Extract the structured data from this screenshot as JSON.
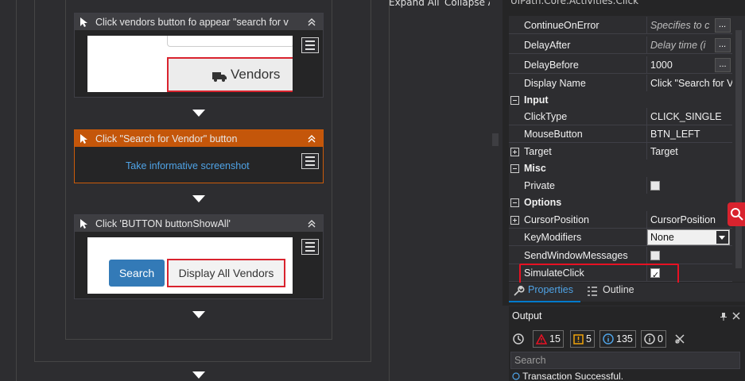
{
  "toolbar": {
    "expand_all": "Expand All",
    "collapse_all": "Collapse All"
  },
  "activities": [
    {
      "title": "Click vendors button fo appear \"search for v",
      "button_text": "Vendors"
    },
    {
      "title": "Click \"Search for Vendor\" button",
      "link": "Take informative screenshot"
    },
    {
      "title": "Click 'BUTTON  buttonShowAll'",
      "search_button": "Search",
      "display_button": "Display All Vendors"
    }
  ],
  "properties": {
    "title": "UiPath.Core.Activities.Click",
    "rows_common": [
      {
        "name": "ContinueOnError",
        "value": "Specifies to c",
        "hint": true,
        "dots": "..."
      },
      {
        "name": "DelayAfter",
        "value": "Delay time (i",
        "hint": true,
        "dots": "..."
      },
      {
        "name": "DelayBefore",
        "value": "1000",
        "hint": false,
        "dots": "..."
      },
      {
        "name": "Display Name",
        "value": "Click \"Search for V",
        "hint": false
      }
    ],
    "cat_input": "Input",
    "rows_input": [
      {
        "name": "ClickType",
        "value": "CLICK_SINGLE"
      },
      {
        "name": "MouseButton",
        "value": "BTN_LEFT"
      },
      {
        "name": "Target",
        "value": "Target"
      }
    ],
    "cat_misc": "Misc",
    "rows_misc": [
      {
        "name": "Private",
        "checked": false
      }
    ],
    "cat_options": "Options",
    "rows_options": [
      {
        "name": "CursorPosition",
        "value": "CursorPosition"
      },
      {
        "name": "KeyModifiers",
        "value": "None"
      },
      {
        "name": "SendWindowMessages",
        "checked": false
      },
      {
        "name": "SimulateClick",
        "checked": true
      }
    ],
    "highlight_color": "#e81123"
  },
  "tabs": {
    "properties": "Properties",
    "outline": "Outline"
  },
  "output": {
    "title": "Output",
    "errors": "15",
    "warnings": "5",
    "info": "135",
    "trace": "0",
    "search_placeholder": "Search",
    "line": "Transaction Successful."
  }
}
